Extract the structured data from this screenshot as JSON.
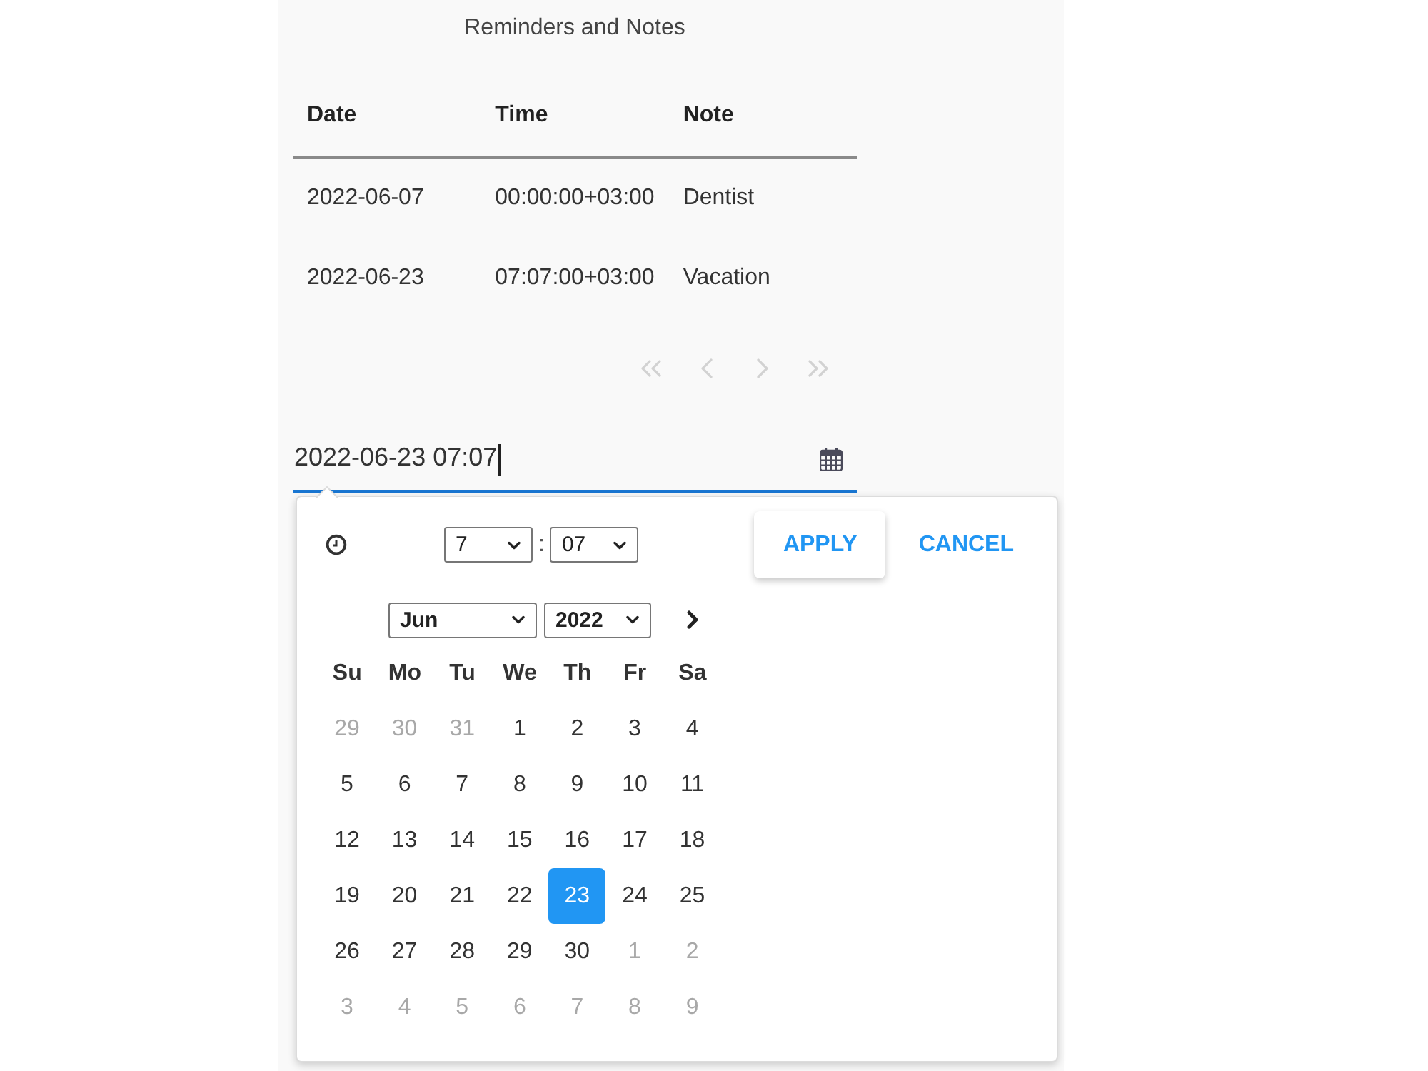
{
  "page": {
    "title": "Reminders and Notes"
  },
  "table": {
    "columns": [
      "Date",
      "Time",
      "Note"
    ],
    "rows": [
      [
        "2022-06-07",
        "00:00:00+03:00",
        "Dentist"
      ],
      [
        "2022-06-23",
        "07:07:00+03:00",
        "Vacation"
      ]
    ]
  },
  "pagination": {
    "first": {
      "disabled": true
    },
    "previous": {
      "disabled": true
    },
    "next": {
      "disabled": true
    },
    "last": {
      "disabled": true
    }
  },
  "date_input": {
    "value": "2022-06-23 07:07",
    "focused": true
  },
  "picker": {
    "hour": "7",
    "separator": ":",
    "minute": "07",
    "apply_button": {
      "label": "APPLY"
    },
    "cancel_button": {
      "label": "CANCEL"
    },
    "month": "Jun",
    "year": "2022",
    "weekdays": [
      "Su",
      "Mo",
      "Tu",
      "We",
      "Th",
      "Fr",
      "Sa"
    ],
    "weeks": [
      [
        {
          "day": "29",
          "outside": true,
          "selected": false
        },
        {
          "day": "30",
          "outside": true,
          "selected": false
        },
        {
          "day": "31",
          "outside": true,
          "selected": false
        },
        {
          "day": "1",
          "outside": false,
          "selected": false
        },
        {
          "day": "2",
          "outside": false,
          "selected": false
        },
        {
          "day": "3",
          "outside": false,
          "selected": false
        },
        {
          "day": "4",
          "outside": false,
          "selected": false
        }
      ],
      [
        {
          "day": "5",
          "outside": false,
          "selected": false
        },
        {
          "day": "6",
          "outside": false,
          "selected": false
        },
        {
          "day": "7",
          "outside": false,
          "selected": false
        },
        {
          "day": "8",
          "outside": false,
          "selected": false
        },
        {
          "day": "9",
          "outside": false,
          "selected": false
        },
        {
          "day": "10",
          "outside": false,
          "selected": false
        },
        {
          "day": "11",
          "outside": false,
          "selected": false
        }
      ],
      [
        {
          "day": "12",
          "outside": false,
          "selected": false
        },
        {
          "day": "13",
          "outside": false,
          "selected": false
        },
        {
          "day": "14",
          "outside": false,
          "selected": false
        },
        {
          "day": "15",
          "outside": false,
          "selected": false
        },
        {
          "day": "16",
          "outside": false,
          "selected": false
        },
        {
          "day": "17",
          "outside": false,
          "selected": false
        },
        {
          "day": "18",
          "outside": false,
          "selected": false
        }
      ],
      [
        {
          "day": "19",
          "outside": false,
          "selected": false
        },
        {
          "day": "20",
          "outside": false,
          "selected": false
        },
        {
          "day": "21",
          "outside": false,
          "selected": false
        },
        {
          "day": "22",
          "outside": false,
          "selected": false
        },
        {
          "day": "23",
          "outside": false,
          "selected": true
        },
        {
          "day": "24",
          "outside": false,
          "selected": false
        },
        {
          "day": "25",
          "outside": false,
          "selected": false
        }
      ],
      [
        {
          "day": "26",
          "outside": false,
          "selected": false
        },
        {
          "day": "27",
          "outside": false,
          "selected": false
        },
        {
          "day": "28",
          "outside": false,
          "selected": false
        },
        {
          "day": "29",
          "outside": false,
          "selected": false
        },
        {
          "day": "30",
          "outside": false,
          "selected": false
        },
        {
          "day": "1",
          "outside": true,
          "selected": false
        },
        {
          "day": "2",
          "outside": true,
          "selected": false
        }
      ],
      [
        {
          "day": "3",
          "outside": true,
          "selected": false
        },
        {
          "day": "4",
          "outside": true,
          "selected": false
        },
        {
          "day": "5",
          "outside": true,
          "selected": false
        },
        {
          "day": "6",
          "outside": true,
          "selected": false
        },
        {
          "day": "7",
          "outside": true,
          "selected": false
        },
        {
          "day": "8",
          "outside": true,
          "selected": false
        },
        {
          "day": "9",
          "outside": true,
          "selected": false
        }
      ]
    ]
  }
}
